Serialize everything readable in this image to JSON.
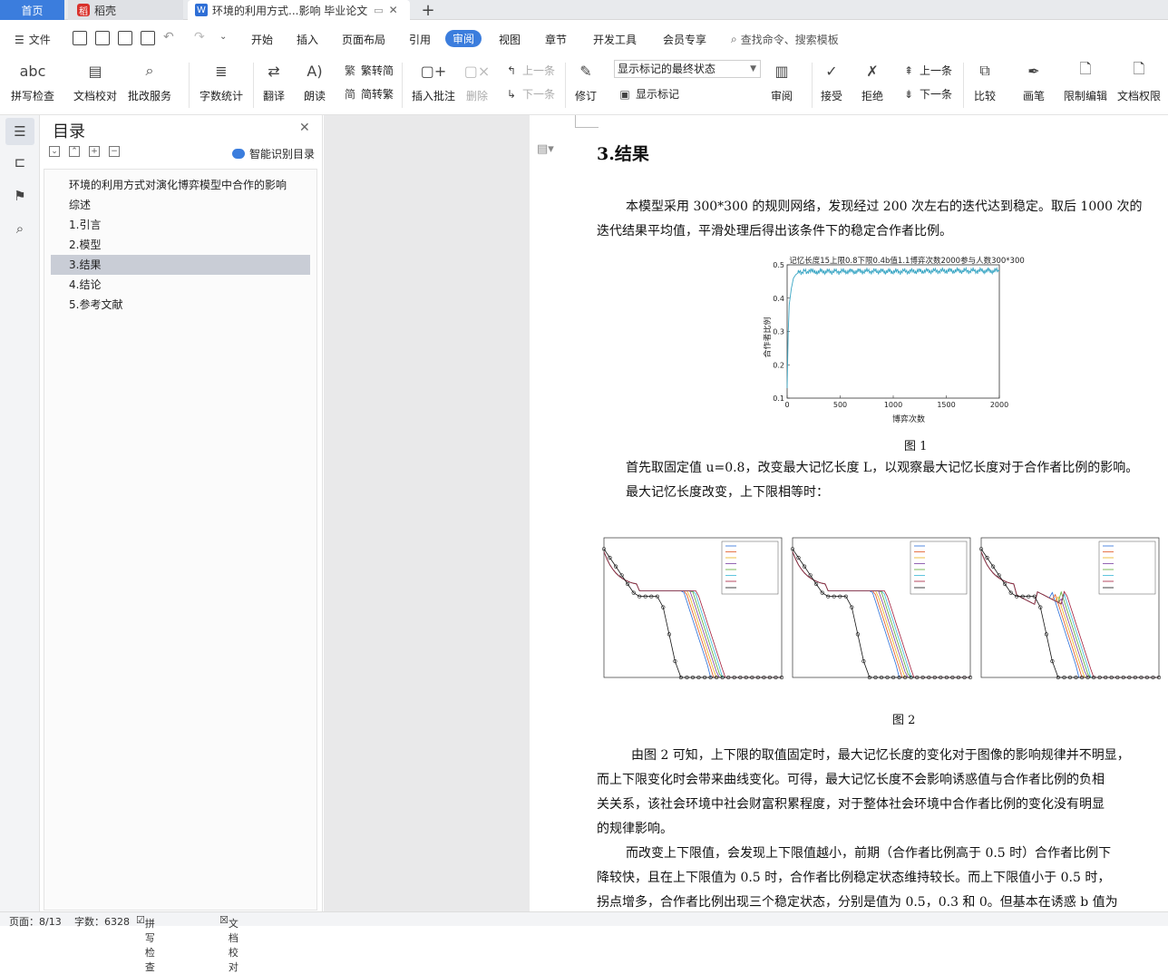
{
  "tabs": {
    "home": "首页",
    "daoke": "稻壳",
    "doc": "环境的利用方式...影响 毕业论文",
    "plus": "+"
  },
  "menu": {
    "file": "文件",
    "items": [
      "开始",
      "插入",
      "页面布局",
      "引用",
      "审阅",
      "视图",
      "章节",
      "开发工具",
      "会员专享"
    ],
    "active": "审阅",
    "search": "查找命令、搜索模板"
  },
  "ribbon": {
    "spell": "拼写检查",
    "doccheck": "文档校对",
    "review_service": "批改服务",
    "wordcount": "字数统计",
    "translate": "翻译",
    "read": "朗读",
    "trad2simp": "繁转简",
    "simp2trad": "简转繁",
    "insert_comment": "插入批注",
    "delete": "删除",
    "prev": "上一条",
    "next": "下一条",
    "revise": "修订",
    "show_mode": "显示标记的最终状态",
    "show_marks": "显示标记",
    "review": "审阅",
    "accept": "接受",
    "reject": "拒绝",
    "prev2": "上一条",
    "next2": "下一条",
    "compare": "比较",
    "pen": "画笔",
    "restrict": "限制编辑",
    "rights": "文档权限"
  },
  "toc": {
    "title": "目录",
    "smart": "智能识别目录",
    "items": [
      "环境的利用方式对演化博弈模型中合作的影响",
      "综述",
      "1.引言",
      "2.模型",
      "3.结果",
      "4.结论",
      "5.参考文献"
    ],
    "selected": "3.结果"
  },
  "doc": {
    "heading": "3.结果",
    "p1a": "本模型采用 300*300 的规则网络，发现经过 200 次左右的迭代达到稳定。取后 1000 次的",
    "p1b": "迭代结果平均值，平滑处理后得出该条件下的稳定合作者比例。",
    "fig1": "图 1",
    "p2a": "首先取固定值 u=0.8，改变最大记忆长度 L，以观察最大记忆长度对于合作者比例的影响。",
    "p2b": "最大记忆长度改变，上下限相等时：",
    "fig2": "图 2",
    "p3a": "由图 2 可知，上下限的取值固定时，最大记忆长度的变化对于图像的影响规律并不明显，",
    "p3b": "而上下限变化时会带来曲线变化。可得，最大记忆长度不会影响诱惑值与合作者比例的负相",
    "p3c": "关关系，该社会环境中社会财富积累程度，对于整体社会环境中合作者比例的变化没有明显",
    "p3d": "的规律影响。",
    "p4a": "而改变上下限值，会发现上下限值越小，前期（合作者比例高于 0.5 时）合作者比例下",
    "p4b": "降较快，且在上下限值为 0.5 时，合作者比例稳定状态维持较长。而上下限值小于 0.5 时，",
    "p4c": "拐点增多，合作者比例出现三个稳定状态，分别是值为 0.5，0.3 和 0。但基本在诱惑 b 值为"
  },
  "status": {
    "page": "页面：8/13",
    "words": "字数：6328",
    "spell": "拼写检查",
    "check": "文档校对"
  },
  "chart_data": [
    {
      "type": "line",
      "title": "记忆长度15上限0.8下限0.4b值1.1博弈次数2000参与人数300*300",
      "xlabel": "博弈次数",
      "ylabel": "合作者比例",
      "xlim": [
        0,
        2000
      ],
      "ylim": [
        0.1,
        0.5
      ],
      "xticks": [
        0,
        500,
        1000,
        1500,
        2000
      ],
      "yticks": [
        0.1,
        0.2,
        0.3,
        0.4,
        0.5
      ],
      "series": [
        {
          "x": [
            0,
            10,
            20,
            40,
            60,
            80,
            100,
            150,
            200,
            300,
            500,
            800,
            1000,
            1500,
            2000
          ],
          "y": [
            0.13,
            0.3,
            0.38,
            0.43,
            0.46,
            0.47,
            0.475,
            0.48,
            0.48,
            0.48,
            0.48,
            0.481,
            0.48,
            0.482,
            0.482
          ]
        }
      ]
    }
  ]
}
